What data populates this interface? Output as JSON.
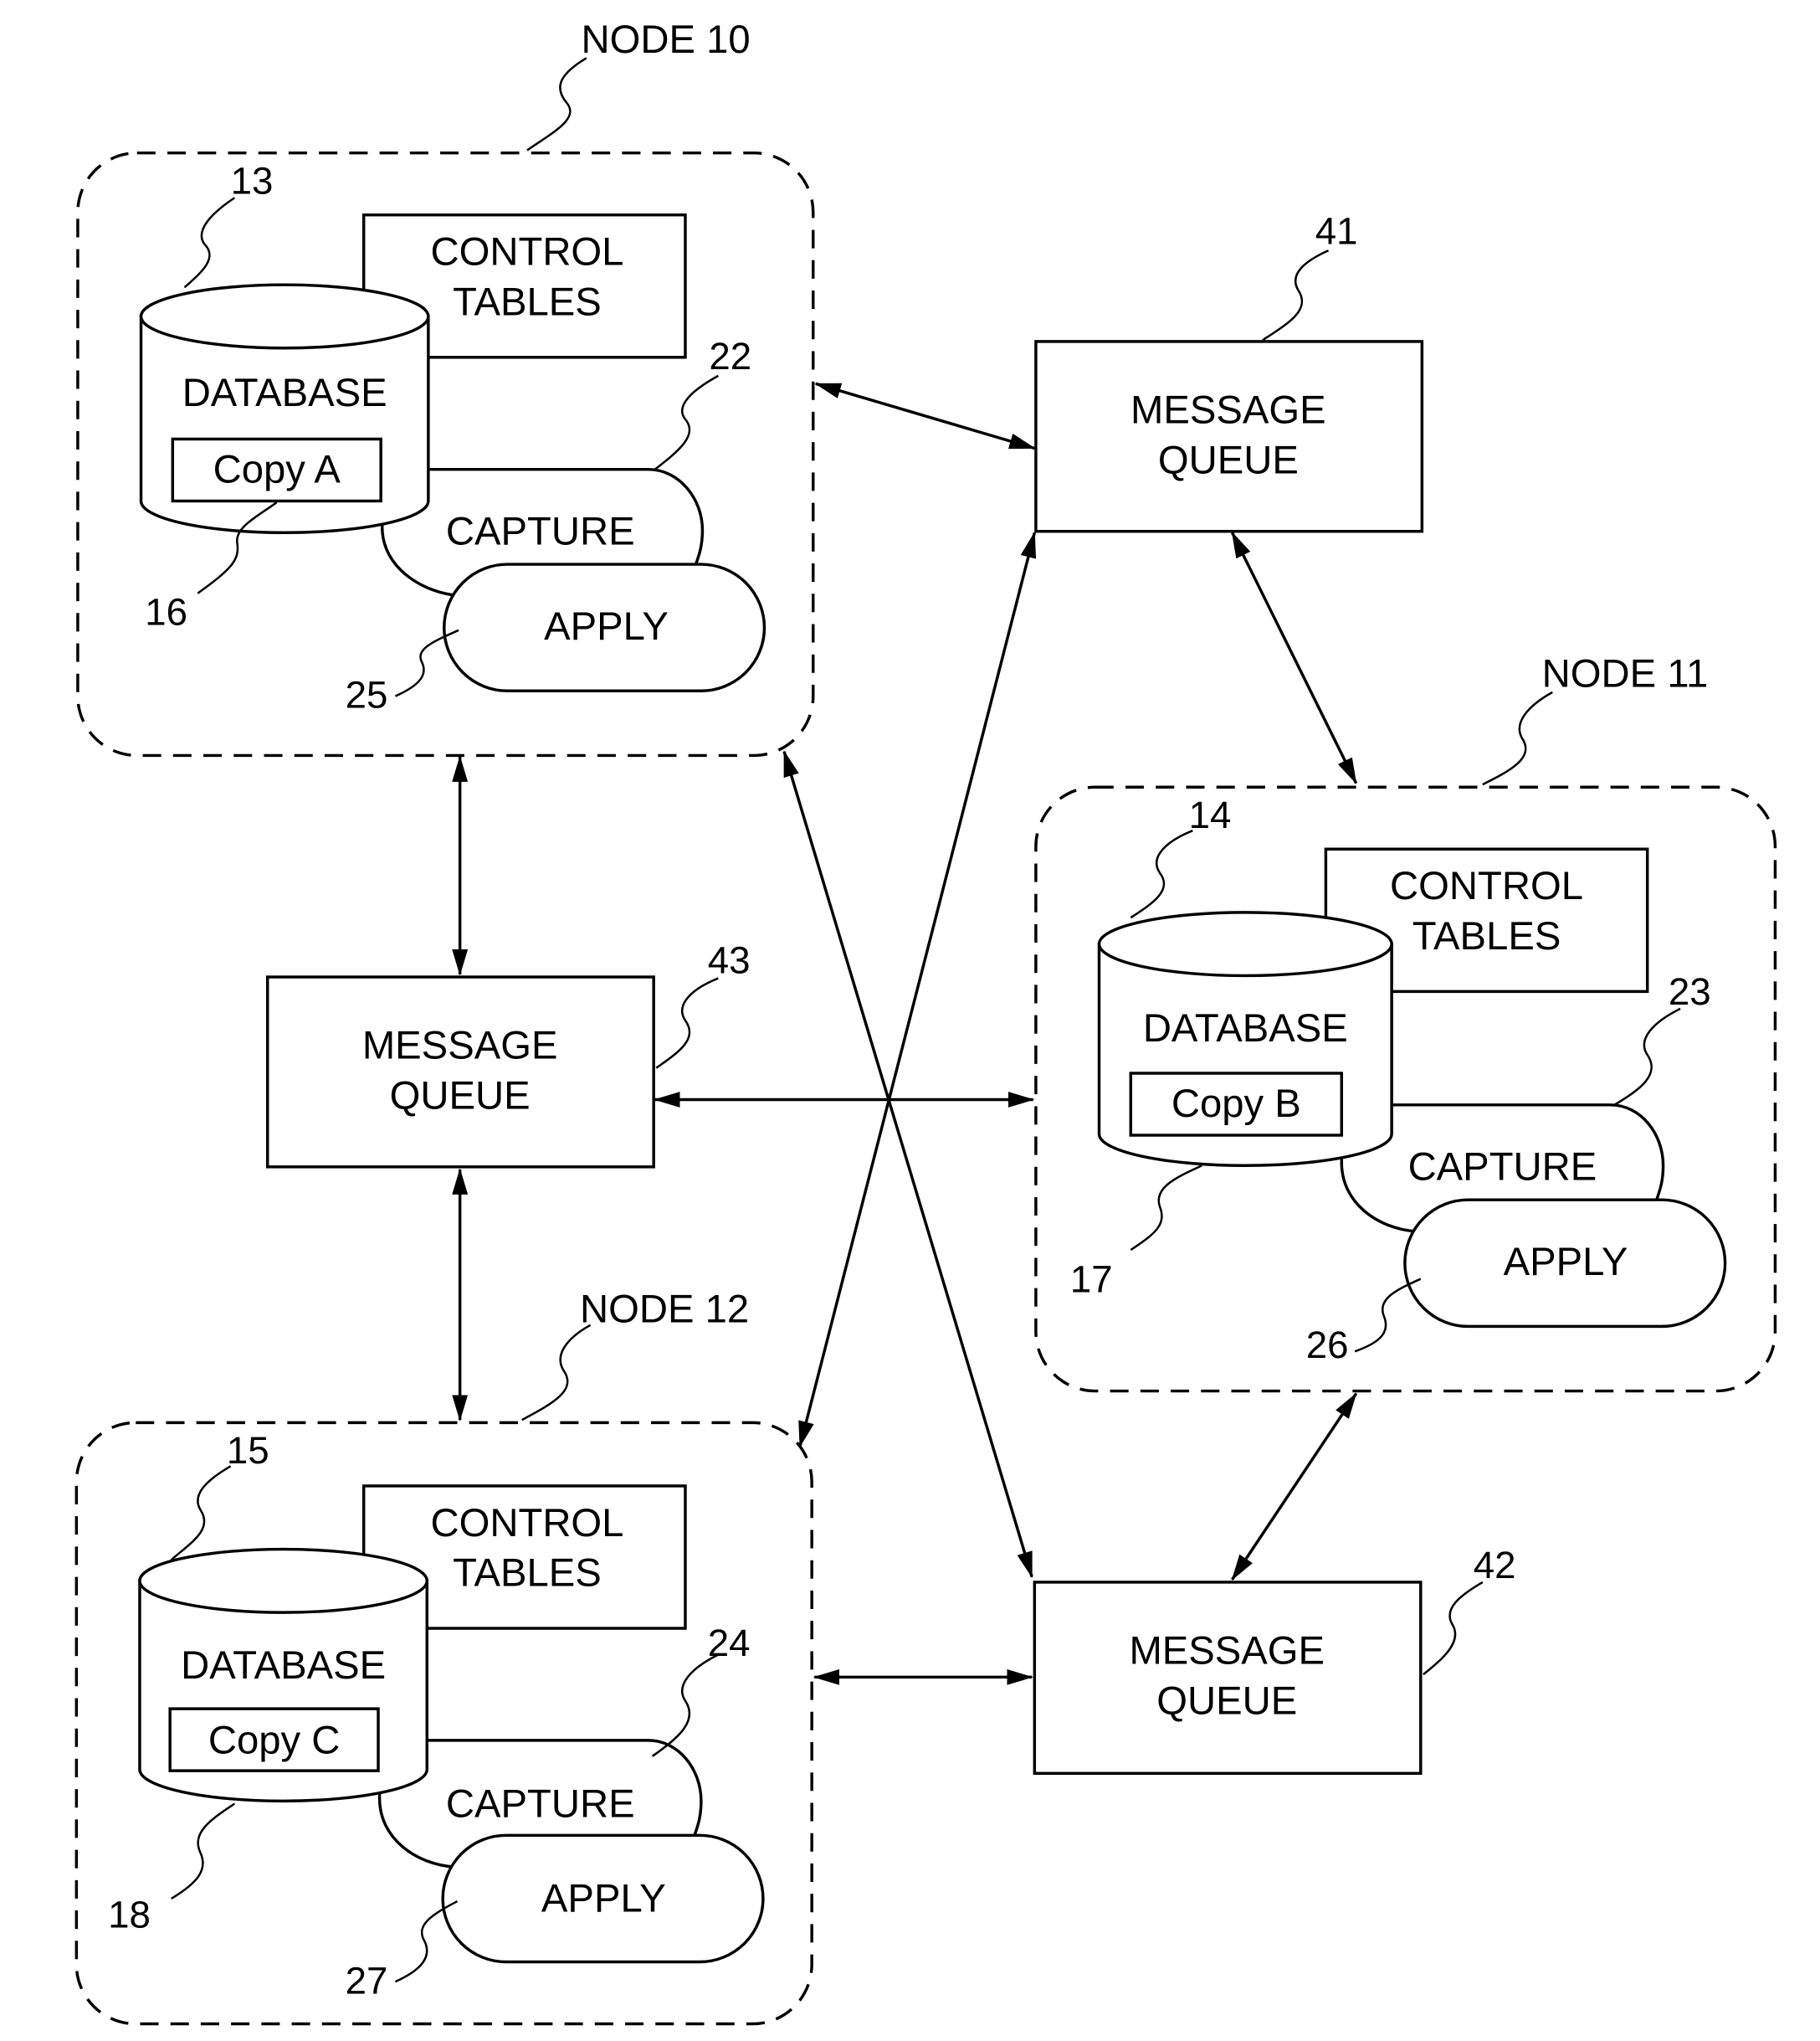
{
  "diagram": {
    "nodes": [
      {
        "label": "NODE 10",
        "database": {
          "label": "DATABASE",
          "ref": "13",
          "copy_label": "Copy A",
          "copy_ref": "16"
        },
        "control_tables": {
          "line1": "CONTROL",
          "line2": "TABLES"
        },
        "capture": {
          "label": "CAPTURE",
          "ref": "22"
        },
        "apply": {
          "label": "APPLY",
          "ref": "25"
        }
      },
      {
        "label": "NODE 11",
        "database": {
          "label": "DATABASE",
          "ref": "14",
          "copy_label": "Copy B",
          "copy_ref": "17"
        },
        "control_tables": {
          "line1": "CONTROL",
          "line2": "TABLES"
        },
        "capture": {
          "label": "CAPTURE",
          "ref": "23"
        },
        "apply": {
          "label": "APPLY",
          "ref": "26"
        }
      },
      {
        "label": "NODE 12",
        "database": {
          "label": "DATABASE",
          "ref": "15",
          "copy_label": "Copy C",
          "copy_ref": "18"
        },
        "control_tables": {
          "line1": "CONTROL",
          "line2": "TABLES"
        },
        "capture": {
          "label": "CAPTURE",
          "ref": "24"
        },
        "apply": {
          "label": "APPLY",
          "ref": "27"
        }
      }
    ],
    "queues": [
      {
        "line1": "MESSAGE",
        "line2": "QUEUE",
        "ref": "41"
      },
      {
        "line1": "MESSAGE",
        "line2": "QUEUE",
        "ref": "42"
      },
      {
        "line1": "MESSAGE",
        "line2": "QUEUE",
        "ref": "43"
      }
    ],
    "connections": [
      {
        "from": "NODE 10",
        "to": "QUEUE 41",
        "bidirectional": true
      },
      {
        "from": "QUEUE 41",
        "to": "NODE 11",
        "bidirectional": true
      },
      {
        "from": "QUEUE 41",
        "to": "NODE 12",
        "bidirectional": true
      },
      {
        "from": "NODE 10",
        "to": "QUEUE 43",
        "bidirectional": true
      },
      {
        "from": "QUEUE 43",
        "to": "NODE 11",
        "bidirectional": true
      },
      {
        "from": "QUEUE 43",
        "to": "NODE 12",
        "bidirectional": true
      },
      {
        "from": "NODE 10",
        "to": "QUEUE 42",
        "bidirectional": true
      },
      {
        "from": "NODE 11",
        "to": "QUEUE 42",
        "bidirectional": true
      },
      {
        "from": "NODE 12",
        "to": "QUEUE 42",
        "bidirectional": true
      }
    ]
  }
}
